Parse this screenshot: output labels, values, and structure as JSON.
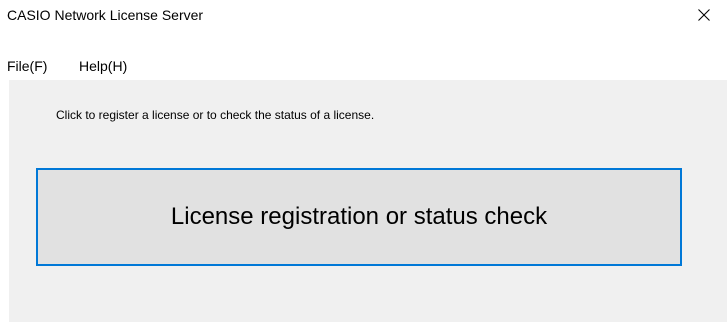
{
  "window": {
    "title": "CASIO Network License Server"
  },
  "menu": {
    "items": [
      {
        "label": "File(F)"
      },
      {
        "label": "Help(H)"
      }
    ]
  },
  "main": {
    "instruction": "Click to register a license or to check the status of a license.",
    "primary_button_label": "License registration or status check"
  },
  "colors": {
    "client_background": "#f0f0f0",
    "button_background": "#e1e1e1",
    "button_focus_border": "#0078d7"
  },
  "icons": {
    "close": "close-icon"
  }
}
